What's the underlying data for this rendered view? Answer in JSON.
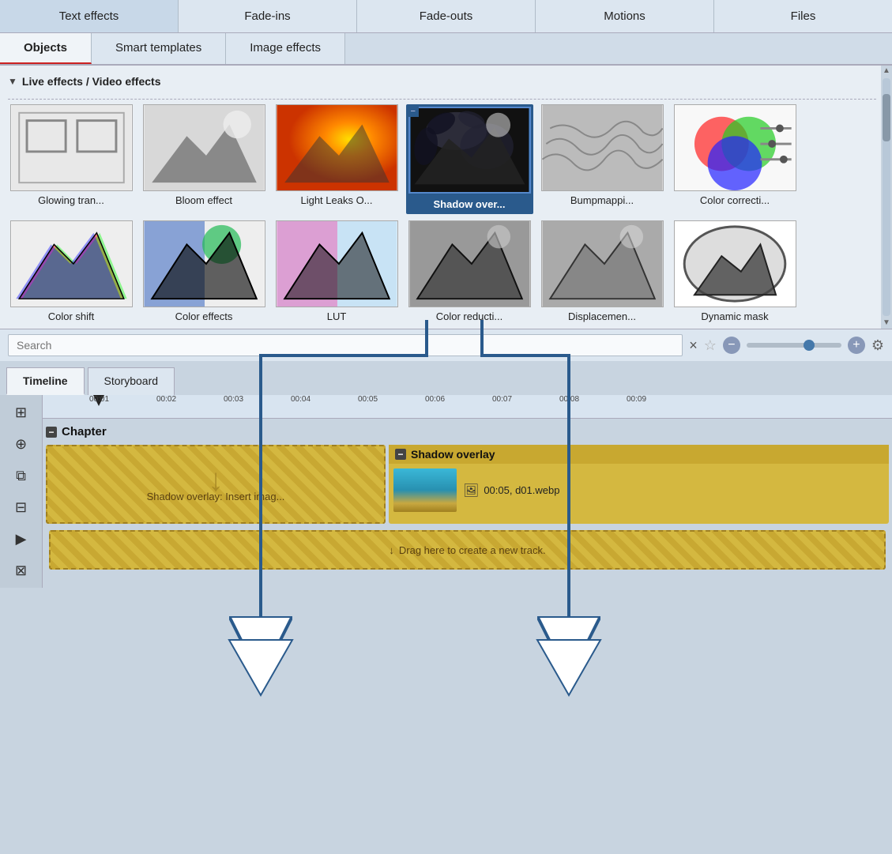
{
  "top_tabs": [
    {
      "label": "Text effects",
      "id": "text-effects"
    },
    {
      "label": "Fade-ins",
      "id": "fade-ins"
    },
    {
      "label": "Fade-outs",
      "id": "fade-outs"
    },
    {
      "label": "Motions",
      "id": "motions"
    },
    {
      "label": "Files",
      "id": "files"
    }
  ],
  "second_tabs": [
    {
      "label": "Objects",
      "id": "objects",
      "active": true
    },
    {
      "label": "Smart templates",
      "id": "smart-templates"
    },
    {
      "label": "Image effects",
      "id": "image-effects"
    }
  ],
  "section_header": "Live effects / Video effects",
  "effects_row1": [
    {
      "label": "Glowing tran...",
      "type": "glowing",
      "id": "glowing-transition"
    },
    {
      "label": "Bloom effect",
      "type": "bloom",
      "id": "bloom-effect"
    },
    {
      "label": "Light Leaks O...",
      "type": "lightleaks",
      "id": "light-leaks"
    },
    {
      "label": "Shadow over...",
      "type": "shadow",
      "id": "shadow-overlay",
      "selected": true
    },
    {
      "label": "Bumpmappi...",
      "type": "bumpmapping",
      "id": "bump-mapping"
    },
    {
      "label": "Color correcti...",
      "type": "colorcorrection",
      "id": "color-correction"
    }
  ],
  "effects_row2": [
    {
      "label": "Color shift",
      "type": "colorshift",
      "id": "color-shift"
    },
    {
      "label": "Color effects",
      "type": "coloreffects",
      "id": "color-effects"
    },
    {
      "label": "LUT",
      "type": "lut",
      "id": "lut"
    },
    {
      "label": "Color reducti...",
      "type": "colorreduction",
      "id": "color-reduction"
    },
    {
      "label": "Displacemen...",
      "type": "displacement",
      "id": "displacement"
    },
    {
      "label": "Dynamic mask",
      "type": "dynamicmask",
      "id": "dynamic-mask"
    }
  ],
  "search": {
    "placeholder": "Search",
    "value": "",
    "clear_label": "×"
  },
  "timeline_tabs": [
    {
      "label": "Timeline",
      "id": "timeline",
      "active": true
    },
    {
      "label": "Storyboard",
      "id": "storyboard"
    }
  ],
  "chapter_label": "Chapter",
  "main_track_text": "Shadow overlay: Insert imag...",
  "shadow_track": {
    "label": "Shadow overlay",
    "clip_info": "00:05, d01.webp"
  },
  "drag_new_track": "Drag here to create a new track.",
  "ruler_marks": [
    "00:01",
    "00:02",
    "00:03",
    "00:04",
    "00:05",
    "00:06",
    "00:07",
    "00:08",
    "00:09"
  ],
  "toolbar_icons": [
    {
      "name": "grid-icon",
      "symbol": "⊞"
    },
    {
      "name": "add-track-icon",
      "symbol": "⊕"
    },
    {
      "name": "duplicate-icon",
      "symbol": "⧉"
    },
    {
      "name": "layers-icon",
      "symbol": "⊟"
    },
    {
      "name": "play-icon",
      "symbol": "▶"
    },
    {
      "name": "split-icon",
      "symbol": "⊠"
    }
  ]
}
